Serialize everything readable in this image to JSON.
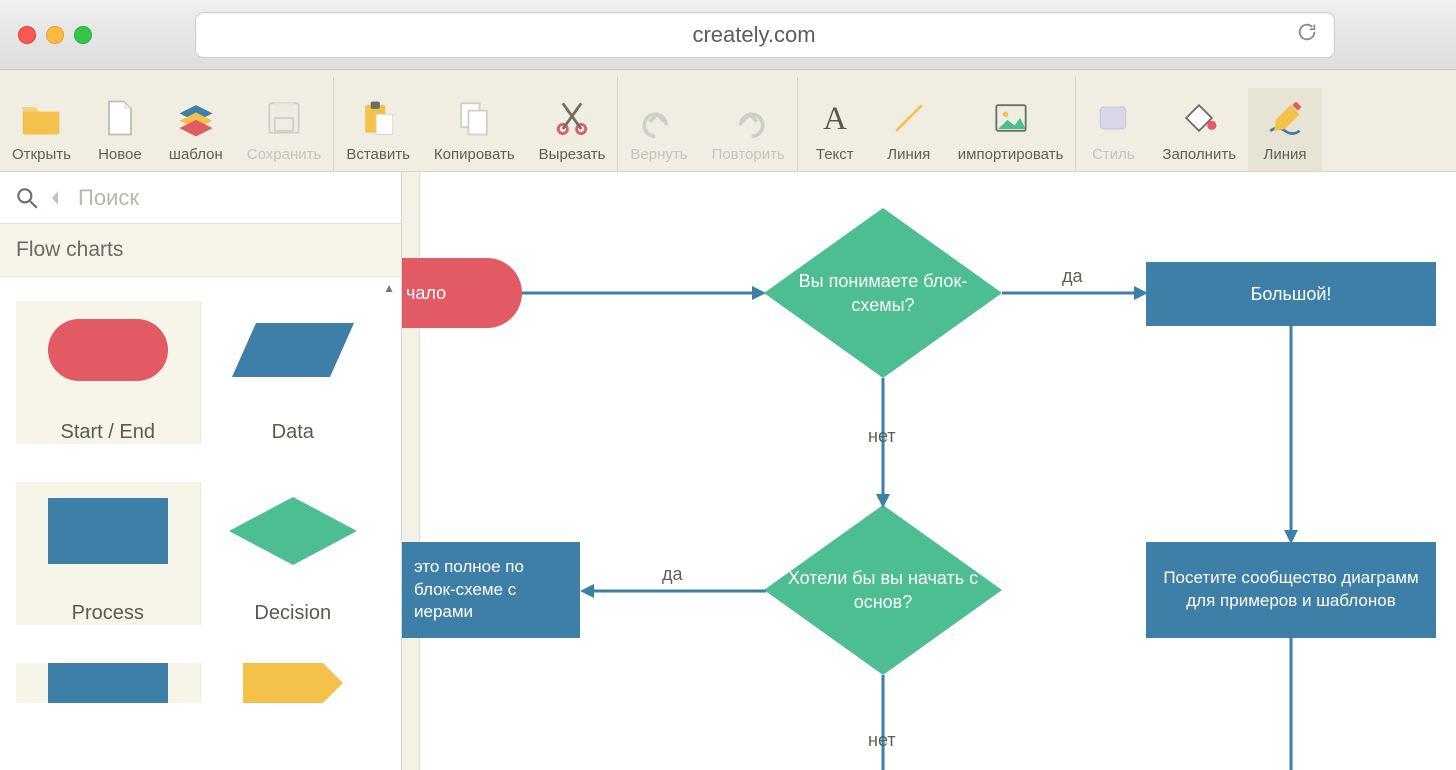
{
  "browser": {
    "url": "creately.com"
  },
  "toolbar": {
    "open": "Открыть",
    "new": "Новое",
    "template": "шаблон",
    "save": "Сохранить",
    "paste": "Вставить",
    "copy": "Копировать",
    "cut": "Вырезать",
    "undo": "Вернуть",
    "redo": "Повторить",
    "text": "Текст",
    "line": "Линия",
    "import": "импортировать",
    "style": "Стиль",
    "fill": "Заполнить",
    "line2": "Линия"
  },
  "sidebar": {
    "search_placeholder": "Поиск",
    "section_title": "Flow charts",
    "shapes": {
      "start_end": "Start / End",
      "data": "Data",
      "process": "Process",
      "decision": "Decision"
    }
  },
  "canvas": {
    "nodes": {
      "start": "чало",
      "decision1": "Вы понимаете блок-схемы?",
      "great": "Большой!",
      "decision2": "Хотели бы вы начать  с основ?",
      "guide": "это полное по блок-схеме с иерами",
      "community": "Посетите сообщество диаграмм для примеров и шаблонов"
    },
    "edges": {
      "yes": "да",
      "no": "нет"
    }
  }
}
